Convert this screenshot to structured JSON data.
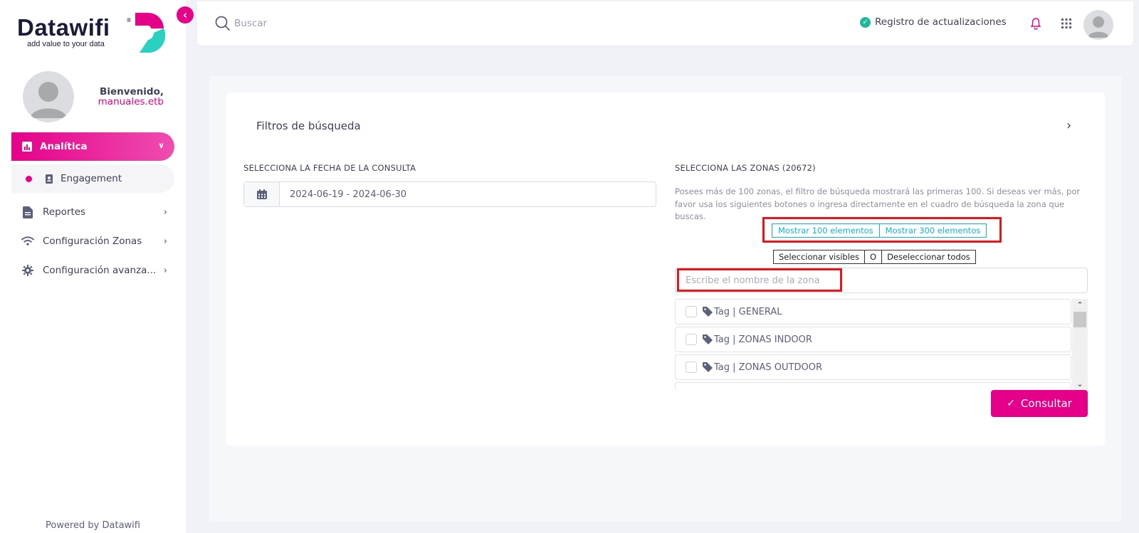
{
  "brand": {
    "name": "Datawifi",
    "registered": "®",
    "tagline": "add value to your data",
    "primary_color": "#e5008a",
    "secondary_color": "#2ad1c0"
  },
  "sidebar": {
    "welcome": "Bienvenido,",
    "username": "manuales.etb",
    "active_section": {
      "label": "Analítica",
      "icon": "bar-chart-icon"
    },
    "sub_item": {
      "label": "Engagement",
      "icon": "contact-book-icon"
    },
    "items": [
      {
        "label": "Reportes",
        "icon": "document-icon"
      },
      {
        "label": "Configuración Zonas",
        "icon": "wifi-icon"
      },
      {
        "label": "Configuración avanza...",
        "icon": "gear-icon"
      }
    ],
    "footer": "Powered by Datawifi"
  },
  "topbar": {
    "search_placeholder": "Buscar",
    "updates_label": "Registro de actualizaciones"
  },
  "filters": {
    "title": "Filtros de búsqueda",
    "date_label": "SELECCIONA LA FECHA DE LA CONSULTA",
    "date_value": "2024-06-19 - 2024-06-30",
    "zones_label": "SELECCIONA LAS ZONAS (20672)",
    "zones_note": "Posees más de 100 zonas, el filtro de búsqueda mostrará las primeras 100. Si deseas ver más, por favor usa los siguientes botones o ingresa directamente en el cuadro de búsqueda la zona que buscas.",
    "show_100": "Mostrar 100 elementos",
    "show_300": "Mostrar 300 elementos",
    "select_visible": "Seleccionar visibles",
    "or_label": "O",
    "deselect_all": "Deseleccionar todos",
    "zone_search_placeholder": "Escribe el nombre de la zona",
    "zones": [
      {
        "label": "Tag | GENERAL"
      },
      {
        "label": "Tag | ZONAS INDOOR"
      },
      {
        "label": "Tag | ZONAS OUTDOOR"
      }
    ],
    "submit": "Consultar"
  }
}
